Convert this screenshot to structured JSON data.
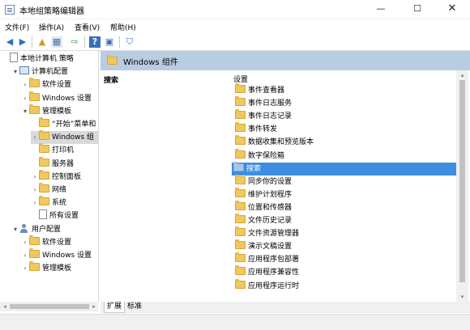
{
  "window": {
    "title": "本地组策略编辑器",
    "minimize": "—",
    "maximize": "☐",
    "close": "✕"
  },
  "menu": [
    "文件(F)",
    "操作(A)",
    "查看(V)",
    "帮助(H)"
  ],
  "toolbar": {
    "back": "◀",
    "forward": "▶",
    "up": "▲",
    "show_hide": "▦",
    "export": "⇨",
    "help": "?",
    "properties": "▣",
    "filter": "⛉"
  },
  "tree": [
    {
      "label": "本地计算机 策略",
      "indent": 0,
      "icon": "doc-icon",
      "arrow": ""
    },
    {
      "label": "计算机配置",
      "indent": 1,
      "icon": "pc-icon",
      "arrow": "▾"
    },
    {
      "label": "软件设置",
      "indent": 2,
      "icon": "folder-icon",
      "arrow": "›"
    },
    {
      "label": "Windows 设置",
      "indent": 2,
      "icon": "folder-icon",
      "arrow": "›"
    },
    {
      "label": "管理模板",
      "indent": 2,
      "icon": "folder-icon",
      "arrow": "▾"
    },
    {
      "label": "“开始”菜单和",
      "indent": 3,
      "icon": "folder-icon",
      "arrow": ""
    },
    {
      "label": "Windows 组",
      "indent": 3,
      "icon": "folder-icon",
      "arrow": "›",
      "selected": true
    },
    {
      "label": "打印机",
      "indent": 3,
      "icon": "folder-icon",
      "arrow": ""
    },
    {
      "label": "服务器",
      "indent": 3,
      "icon": "folder-icon",
      "arrow": ""
    },
    {
      "label": "控制面板",
      "indent": 3,
      "icon": "folder-icon",
      "arrow": "›"
    },
    {
      "label": "网络",
      "indent": 3,
      "icon": "folder-icon",
      "arrow": "›"
    },
    {
      "label": "系统",
      "indent": 3,
      "icon": "folder-icon",
      "arrow": "›"
    },
    {
      "label": "所有设置",
      "indent": 3,
      "icon": "doc-icon",
      "arrow": ""
    },
    {
      "label": "用户配置",
      "indent": 1,
      "icon": "user-icon",
      "arrow": "▾"
    },
    {
      "label": "软件设置",
      "indent": 2,
      "icon": "folder-icon",
      "arrow": "›"
    },
    {
      "label": "Windows 设置",
      "indent": 2,
      "icon": "folder-icon",
      "arrow": "›"
    },
    {
      "label": "管理模板",
      "indent": 2,
      "icon": "folder-icon",
      "arrow": "›"
    }
  ],
  "right": {
    "header_title": "Windows 组件",
    "desc_title": "搜索",
    "list_header": "设置",
    "items": [
      {
        "label": "事件查看器"
      },
      {
        "label": "事件日志服务"
      },
      {
        "label": "事件日志记录"
      },
      {
        "label": "事件转发"
      },
      {
        "label": "数据收集和预览版本"
      },
      {
        "label": "数字保险箱"
      },
      {
        "label": "搜索",
        "selected": true
      },
      {
        "label": "同步你的设置"
      },
      {
        "label": "维护计划程序"
      },
      {
        "label": "位置和传感器"
      },
      {
        "label": "文件历史记录"
      },
      {
        "label": "文件资源管理器"
      },
      {
        "label": "演示文稿设置"
      },
      {
        "label": "应用程序包部署"
      },
      {
        "label": "应用程序兼容性"
      },
      {
        "label": "应用程序运行时"
      }
    ]
  },
  "tabs": [
    "扩展",
    "标准"
  ],
  "scroll": {
    "left": "◂",
    "right": "▸",
    "up": "▴",
    "down": "▾"
  }
}
